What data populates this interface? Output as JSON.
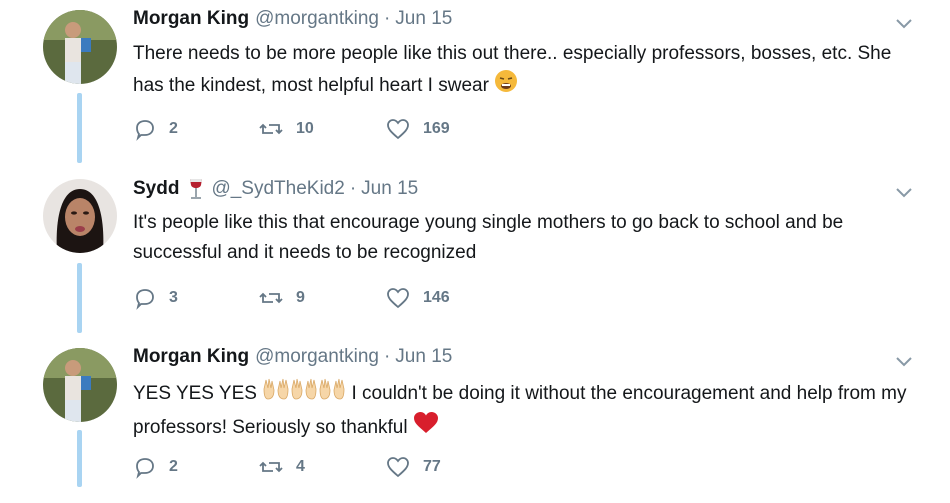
{
  "tweets": [
    {
      "name": "Morgan King",
      "handle": "@morgantking",
      "separator": "·",
      "date": "Jun 15",
      "text_parts": [
        "There needs to be more people like this out there.. especially professors, bosses, etc. She has the kindest, most helpful heart I swear"
      ],
      "emojis": [
        "weary-face-emoji"
      ],
      "replies": "2",
      "retweets": "10",
      "likes": "169"
    },
    {
      "name": "Sydd",
      "name_icon": "wine-glass-icon",
      "handle": "@_SydTheKid2",
      "separator": "·",
      "date": "Jun 15",
      "text_parts": [
        "It's people like this that encourage young single mothers to go back to school and be successful and it needs to be recognized"
      ],
      "replies": "3",
      "retweets": "9",
      "likes": "146"
    },
    {
      "name": "Morgan King",
      "handle": "@morgantking",
      "separator": "·",
      "date": "Jun 15",
      "text_parts": [
        "YES YES YES",
        "I couldn't be doing it without the encouragement and help from my professors! Seriously so thankful"
      ],
      "emojis": [
        "raising-hands-emoji",
        "raising-hands-emoji",
        "raising-hands-emoji",
        "red-heart-emoji"
      ],
      "replies": "2",
      "retweets": "4",
      "likes": "77"
    }
  ],
  "colors": {
    "thread_line": "#a9d4f2",
    "muted_text": "#657786",
    "body_text": "#14171a"
  }
}
